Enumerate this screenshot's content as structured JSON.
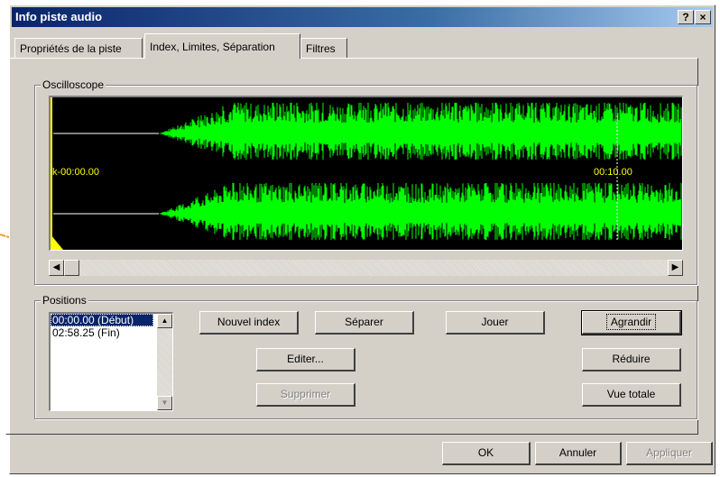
{
  "window": {
    "title": "Info piste audio",
    "help_glyph": "?",
    "close_glyph": "×"
  },
  "tabs": [
    {
      "label": "Propriétés de la piste"
    },
    {
      "label": "Index, Limites, Séparation"
    },
    {
      "label": "Filtres"
    }
  ],
  "oscilloscope": {
    "legend": "Oscilloscope",
    "start_time": "k-00:00.00",
    "marker_time": "00:10.00",
    "colors": {
      "background": "#000000",
      "waveform": "#00ff00",
      "cursor": "#ffff00",
      "time_label": "#ffff00"
    }
  },
  "scrollbar": {
    "left_arrow": "◀",
    "right_arrow": "▶"
  },
  "positions": {
    "legend": "Positions",
    "items": [
      "00:00.00 (Début)",
      "02:58.25 (Fin)"
    ],
    "selected_index": 0
  },
  "buttons": {
    "new_index": "Nouvel index",
    "split": "Séparer",
    "play": "Jouer",
    "zoom_in": "Agrandir",
    "edit": "Editer...",
    "zoom_out": "Réduire",
    "delete": "Supprimer",
    "full_view": "Vue totale",
    "ok": "OK",
    "cancel": "Annuler",
    "apply": "Appliquer"
  },
  "colors": {
    "titlebar": "#0a246a",
    "face": "#d4d0c8",
    "annotation_arrow": "#f0a030"
  }
}
